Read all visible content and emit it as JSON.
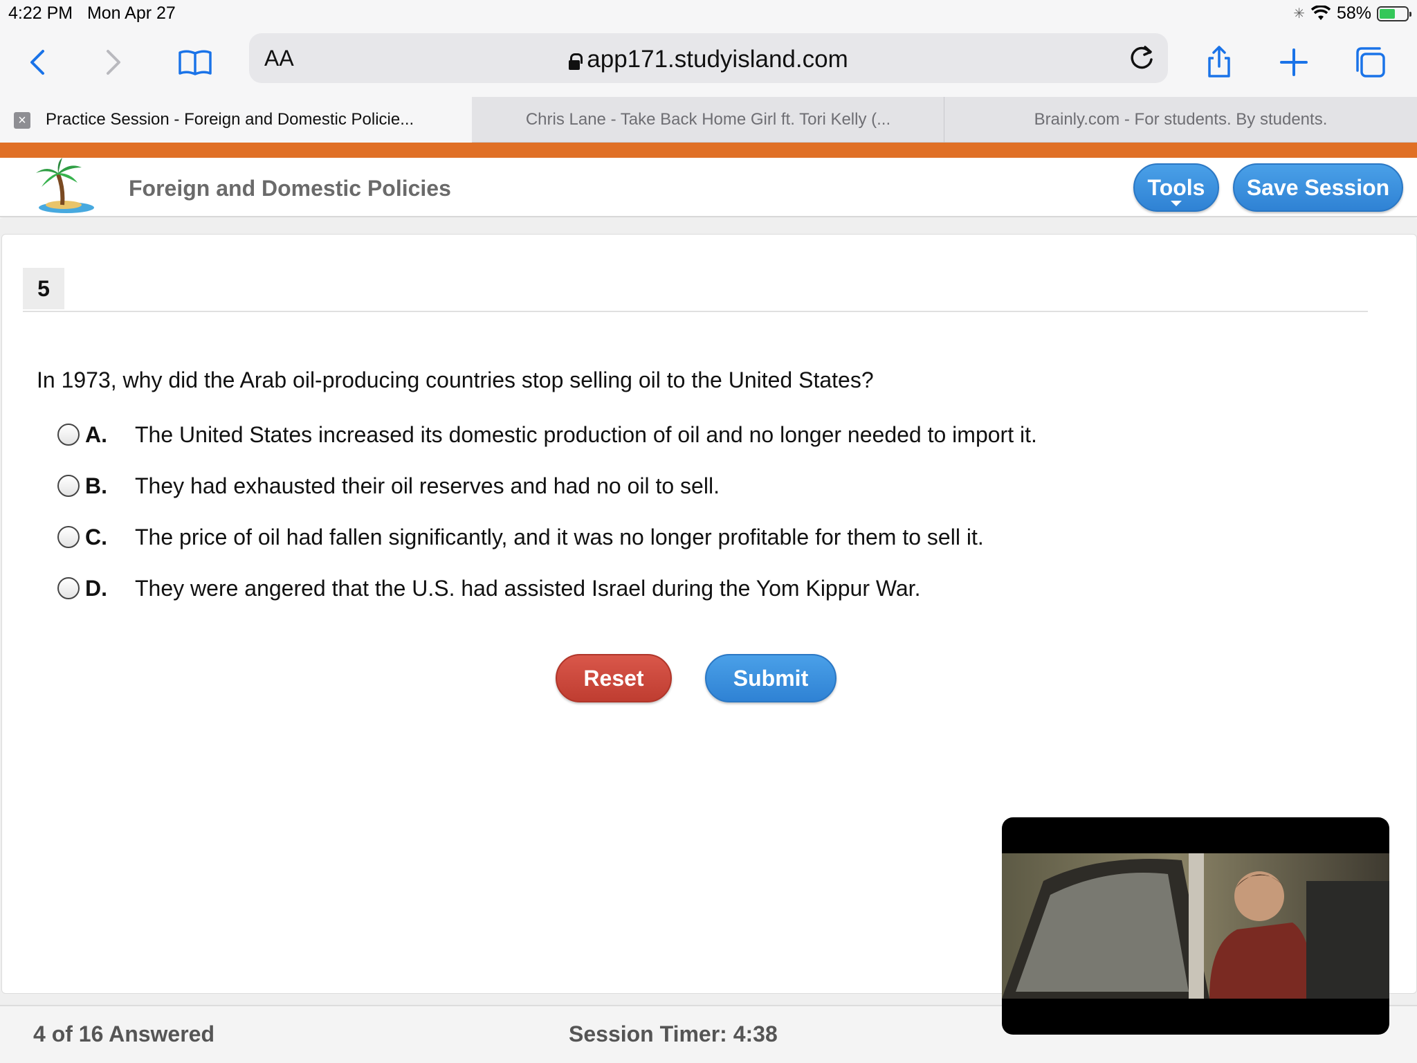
{
  "status_bar": {
    "time": "4:22 PM",
    "date": "Mon Apr 27",
    "battery": "58%",
    "battery_level": 0.58
  },
  "toolbar": {
    "text_size_label": "AA",
    "url": "app171.studyisland.com",
    "icons": [
      "back-icon",
      "forward-icon",
      "bookmarks-icon",
      "lock-icon",
      "reload-icon",
      "share-icon",
      "new-tab-icon",
      "tabs-icon"
    ]
  },
  "tabs": [
    {
      "title": "Practice Session - Foreign and Domestic Policie...",
      "active": true
    },
    {
      "title": "Chris Lane - Take Back Home Girl ft. Tori Kelly (...",
      "active": false
    },
    {
      "title": "Brainly.com - For students. By students.",
      "active": false
    }
  ],
  "header": {
    "title": "Foreign and Domestic Policies",
    "tools_label": "Tools",
    "save_label": "Save Session"
  },
  "question": {
    "number": "5",
    "text": "In 1973, why did the Arab oil-producing countries stop selling oil to the United States?",
    "choices": [
      {
        "letter": "A.",
        "text": "The United States increased its domestic production of oil and no longer needed to import it."
      },
      {
        "letter": "B.",
        "text": "They had exhausted their oil reserves and had no oil to sell."
      },
      {
        "letter": "C.",
        "text": "The price of oil had fallen significantly, and it was no longer profitable for them to sell it."
      },
      {
        "letter": "D.",
        "text": "They were angered that the U.S. had assisted Israel during the Yom Kippur War."
      }
    ]
  },
  "actions": {
    "reset_label": "Reset",
    "submit_label": "Submit"
  },
  "footer": {
    "answered": "4 of 16 Answered",
    "timer": "Session Timer: 4:38"
  },
  "colors": {
    "accent_blue": "#2f82d4",
    "reset_red": "#c8453a",
    "header_orange": "#e07026",
    "ios_blue": "#1a73e8"
  }
}
